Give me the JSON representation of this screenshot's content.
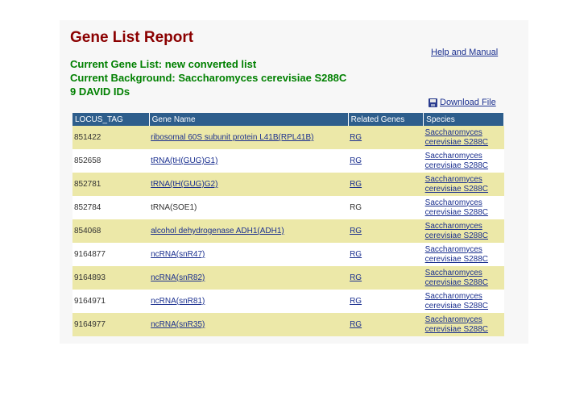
{
  "report": {
    "title": "Gene List Report",
    "current_gene_list": "Current Gene List: new  converted  list",
    "current_background": "Current Background: Saccharomyces cerevisiae S288C",
    "id_count": "9 DAVID IDs",
    "help_link": "Help and Manual",
    "download_link": "Download File"
  },
  "table": {
    "headers": [
      "LOCUS_TAG",
      "Gene Name",
      "Related Genes",
      "Species"
    ],
    "rows": [
      {
        "locus": "851422",
        "gene": "ribosomal 60S subunit protein L41B(RPL41B)",
        "gene_link": true,
        "related": "RG",
        "related_link": true,
        "species1": "Saccharomyces",
        "species2": "cerevisiae S288C"
      },
      {
        "locus": "852658",
        "gene": "tRNA(tH(GUG)G1)",
        "gene_link": true,
        "related": "RG",
        "related_link": true,
        "species1": "Saccharomyces",
        "species2": "cerevisiae S288C"
      },
      {
        "locus": "852781",
        "gene": "tRNA(tH(GUG)G2)",
        "gene_link": true,
        "related": "RG",
        "related_link": true,
        "species1": "Saccharomyces",
        "species2": "cerevisiae S288C"
      },
      {
        "locus": "852784",
        "gene": "tRNA(SOE1)",
        "gene_link": false,
        "related": "RG",
        "related_link": false,
        "species1": "Saccharomyces",
        "species2": "cerevisiae S288C"
      },
      {
        "locus": "854068",
        "gene": "alcohol dehydrogenase ADH1(ADH1)",
        "gene_link": true,
        "related": "RG",
        "related_link": true,
        "species1": "Saccharomyces",
        "species2": "cerevisiae S288C"
      },
      {
        "locus": "9164877",
        "gene": "ncRNA(snR47)",
        "gene_link": true,
        "related": "RG",
        "related_link": true,
        "species1": "Saccharomyces",
        "species2": "cerevisiae S288C"
      },
      {
        "locus": "9164893",
        "gene": "ncRNA(snR82)",
        "gene_link": true,
        "related": "RG",
        "related_link": true,
        "species1": "Saccharomyces",
        "species2": "cerevisiae S288C"
      },
      {
        "locus": "9164971",
        "gene": "ncRNA(snR81)",
        "gene_link": true,
        "related": "RG",
        "related_link": true,
        "species1": "Saccharomyces",
        "species2": "cerevisiae S288C"
      },
      {
        "locus": "9164977",
        "gene": "ncRNA(snR35)",
        "gene_link": true,
        "related": "RG",
        "related_link": true,
        "species1": "Saccharomyces",
        "species2": "cerevisiae S288C"
      }
    ]
  },
  "colors": {
    "title": "#8b0000",
    "info_text": "#008000",
    "header_bg": "#2e5e8c",
    "row_odd": "#ece8a8",
    "link": "#1a2f8f"
  }
}
